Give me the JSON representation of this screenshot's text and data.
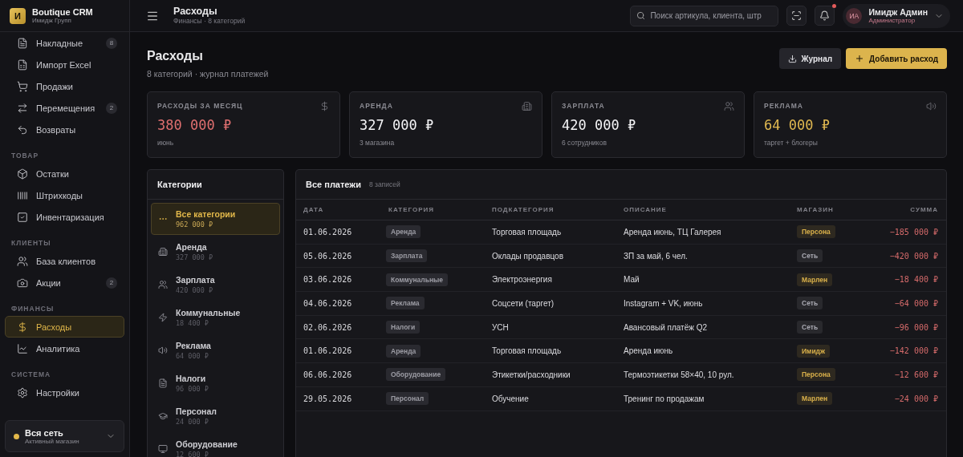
{
  "brand": {
    "logo": "И",
    "name": "Boutique CRM",
    "org": "Имидж Групп"
  },
  "sidebar": {
    "sections": [
      {
        "items": [
          {
            "label": "Накладные",
            "badge": "8",
            "selected": false
          },
          {
            "label": "Импорт Excel",
            "selected": false
          },
          {
            "label": "Продажи",
            "selected": false
          },
          {
            "label": "Перемещения",
            "badge": "2",
            "selected": false
          },
          {
            "label": "Возвраты",
            "selected": false
          }
        ]
      },
      {
        "title": "ТОВАР",
        "items": [
          {
            "label": "Остатки",
            "selected": false
          },
          {
            "label": "Штрихкоды",
            "selected": false
          },
          {
            "label": "Инвентаризация",
            "selected": false
          }
        ]
      },
      {
        "title": "КЛИЕНТЫ",
        "items": [
          {
            "label": "База клиентов",
            "selected": false
          },
          {
            "label": "Акции",
            "badge": "2",
            "selected": false
          }
        ]
      },
      {
        "title": "ФИНАНСЫ",
        "items": [
          {
            "label": "Расходы",
            "selected": true
          },
          {
            "label": "Аналитика",
            "selected": false
          }
        ]
      },
      {
        "title": "СИСТЕМА",
        "items": [
          {
            "label": "Настройки",
            "selected": false
          }
        ]
      }
    ],
    "store": {
      "name": "Вся сеть",
      "hint": "Активный магазин",
      "color": "#e2b84a"
    }
  },
  "header": {
    "title": "Расходы",
    "subtitle": "Финансы · 8 категорий",
    "search": {
      "placeholder": "Поиск артикула, клиента, штр"
    },
    "notification": true,
    "user": {
      "initials": "ИА",
      "name": "Имидж Админ",
      "role": "Администратор"
    }
  },
  "page": {
    "title": "Расходы",
    "subtitle": "8 категорий · журнал платежей",
    "buttons": [
      {
        "label": "Журнал",
        "kind": "secondary"
      },
      {
        "label": "Добавить расход",
        "kind": "primary"
      }
    ]
  },
  "stats": [
    {
      "label": "РАСХОДЫ ЗА МЕСЯЦ",
      "value": "380 000 ₽",
      "note": "июнь",
      "color": "#e07070"
    },
    {
      "label": "АРЕНДА",
      "value": "327 000 ₽",
      "note": "3 магазина",
      "color": "#f4f4f6"
    },
    {
      "label": "ЗАРПЛАТА",
      "value": "420 000 ₽",
      "note": "6 сотрудников",
      "color": "#f4f4f6"
    },
    {
      "label": "РЕКЛАМА",
      "value": "64 000 ₽",
      "note": "таргет + блогеры",
      "color": "#e0b850"
    }
  ],
  "categories": {
    "title": "Категории",
    "items": [
      {
        "name": "Все категории",
        "amount": "962 000 ₽",
        "selected": true
      },
      {
        "name": "Аренда",
        "amount": "327 000 ₽",
        "selected": false
      },
      {
        "name": "Зарплата",
        "amount": "420 000 ₽",
        "selected": false
      },
      {
        "name": "Коммунальные",
        "amount": "18 400 ₽",
        "selected": false
      },
      {
        "name": "Реклама",
        "amount": "64 000 ₽",
        "selected": false
      },
      {
        "name": "Налоги",
        "amount": "96 000 ₽",
        "selected": false
      },
      {
        "name": "Персонал",
        "amount": "24 000 ₽",
        "selected": false
      },
      {
        "name": "Оборудование",
        "amount": "12 600 ₽",
        "selected": false
      }
    ]
  },
  "table": {
    "title": "Все платежи",
    "count": "8 записей",
    "columns": [
      "ДАТА",
      "КАТЕГОРИЯ",
      "ПОДКАТЕГОРИЯ",
      "ОПИСАНИЕ",
      "МАГАЗИН",
      "СУММА"
    ],
    "rows": [
      {
        "date": "01.06.2026",
        "category": "Аренда",
        "subcategory": "Торговая площадь",
        "description": "Аренда июнь, ТЦ Галерея",
        "store": "Персона",
        "color": "#d9b04a",
        "amount": "−185 000 ₽"
      },
      {
        "date": "05.06.2026",
        "category": "Зарплата",
        "subcategory": "Оклады продавцов",
        "description": "ЗП за май, 6 чел.",
        "store": "Сеть",
        "color": "#a9a9b2",
        "amount": "−420 000 ₽"
      },
      {
        "date": "03.06.2026",
        "category": "Коммунальные",
        "subcategory": "Электроэнергия",
        "description": "Май",
        "store": "Марлен",
        "color": "#d9b04a",
        "amount": "−18 400 ₽"
      },
      {
        "date": "04.06.2026",
        "category": "Реклама",
        "subcategory": "Соцсети (таргет)",
        "description": "Instagram + VK, июнь",
        "store": "Сеть",
        "color": "#a9a9b2",
        "amount": "−64 000 ₽"
      },
      {
        "date": "02.06.2026",
        "category": "Налоги",
        "subcategory": "УСН",
        "description": "Авансовый платёж Q2",
        "store": "Сеть",
        "color": "#a9a9b2",
        "amount": "−96 000 ₽"
      },
      {
        "date": "01.06.2026",
        "category": "Аренда",
        "subcategory": "Торговая площадь",
        "description": "Аренда июнь",
        "store": "Имидж",
        "color": "#d9b04a",
        "amount": "−142 000 ₽"
      },
      {
        "date": "06.06.2026",
        "category": "Оборудование",
        "subcategory": "Этикетки/расходники",
        "description": "Термоэтикетки 58×40, 10 рул.",
        "store": "Персона",
        "color": "#d9b04a",
        "amount": "−12 600 ₽"
      },
      {
        "date": "29.05.2026",
        "category": "Персонал",
        "subcategory": "Обучение",
        "description": "Тренинг по продажам",
        "store": "Марлен",
        "color": "#d9b04a",
        "amount": "−24 000 ₽"
      }
    ]
  }
}
